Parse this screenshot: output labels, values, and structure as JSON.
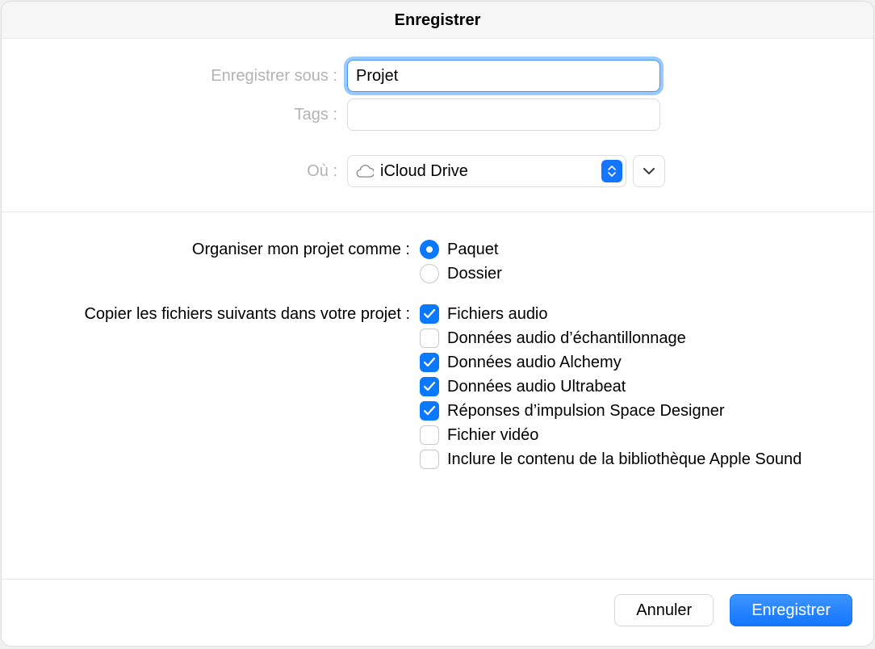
{
  "title": "Enregistrer",
  "labels": {
    "save_as": "Enregistrer sous :",
    "tags": "Tags :",
    "where": "Où :"
  },
  "filename": "Projet",
  "tags": "",
  "where": {
    "location": "iCloud Drive"
  },
  "organize": {
    "label": "Organiser mon projet comme :",
    "options": {
      "package": "Paquet",
      "folder": "Dossier"
    },
    "selected": "package"
  },
  "copy": {
    "label": "Copier les fichiers suivants dans votre projet :",
    "items": [
      {
        "key": "audio_files",
        "label": "Fichiers audio",
        "checked": true
      },
      {
        "key": "sampler_audio",
        "label": "Données audio d’échantillonnage",
        "checked": false
      },
      {
        "key": "alchemy_audio",
        "label": "Données audio Alchemy",
        "checked": true
      },
      {
        "key": "ultrabeat_audio",
        "label": "Données audio Ultrabeat",
        "checked": true
      },
      {
        "key": "space_designer",
        "label": "Réponses d’impulsion Space Designer",
        "checked": true
      },
      {
        "key": "video_file",
        "label": "Fichier vidéo",
        "checked": false
      },
      {
        "key": "apple_sound_lib",
        "label": "Inclure le contenu de la bibliothèque Apple Sound",
        "checked": false
      }
    ]
  },
  "buttons": {
    "cancel": "Annuler",
    "save": "Enregistrer"
  }
}
